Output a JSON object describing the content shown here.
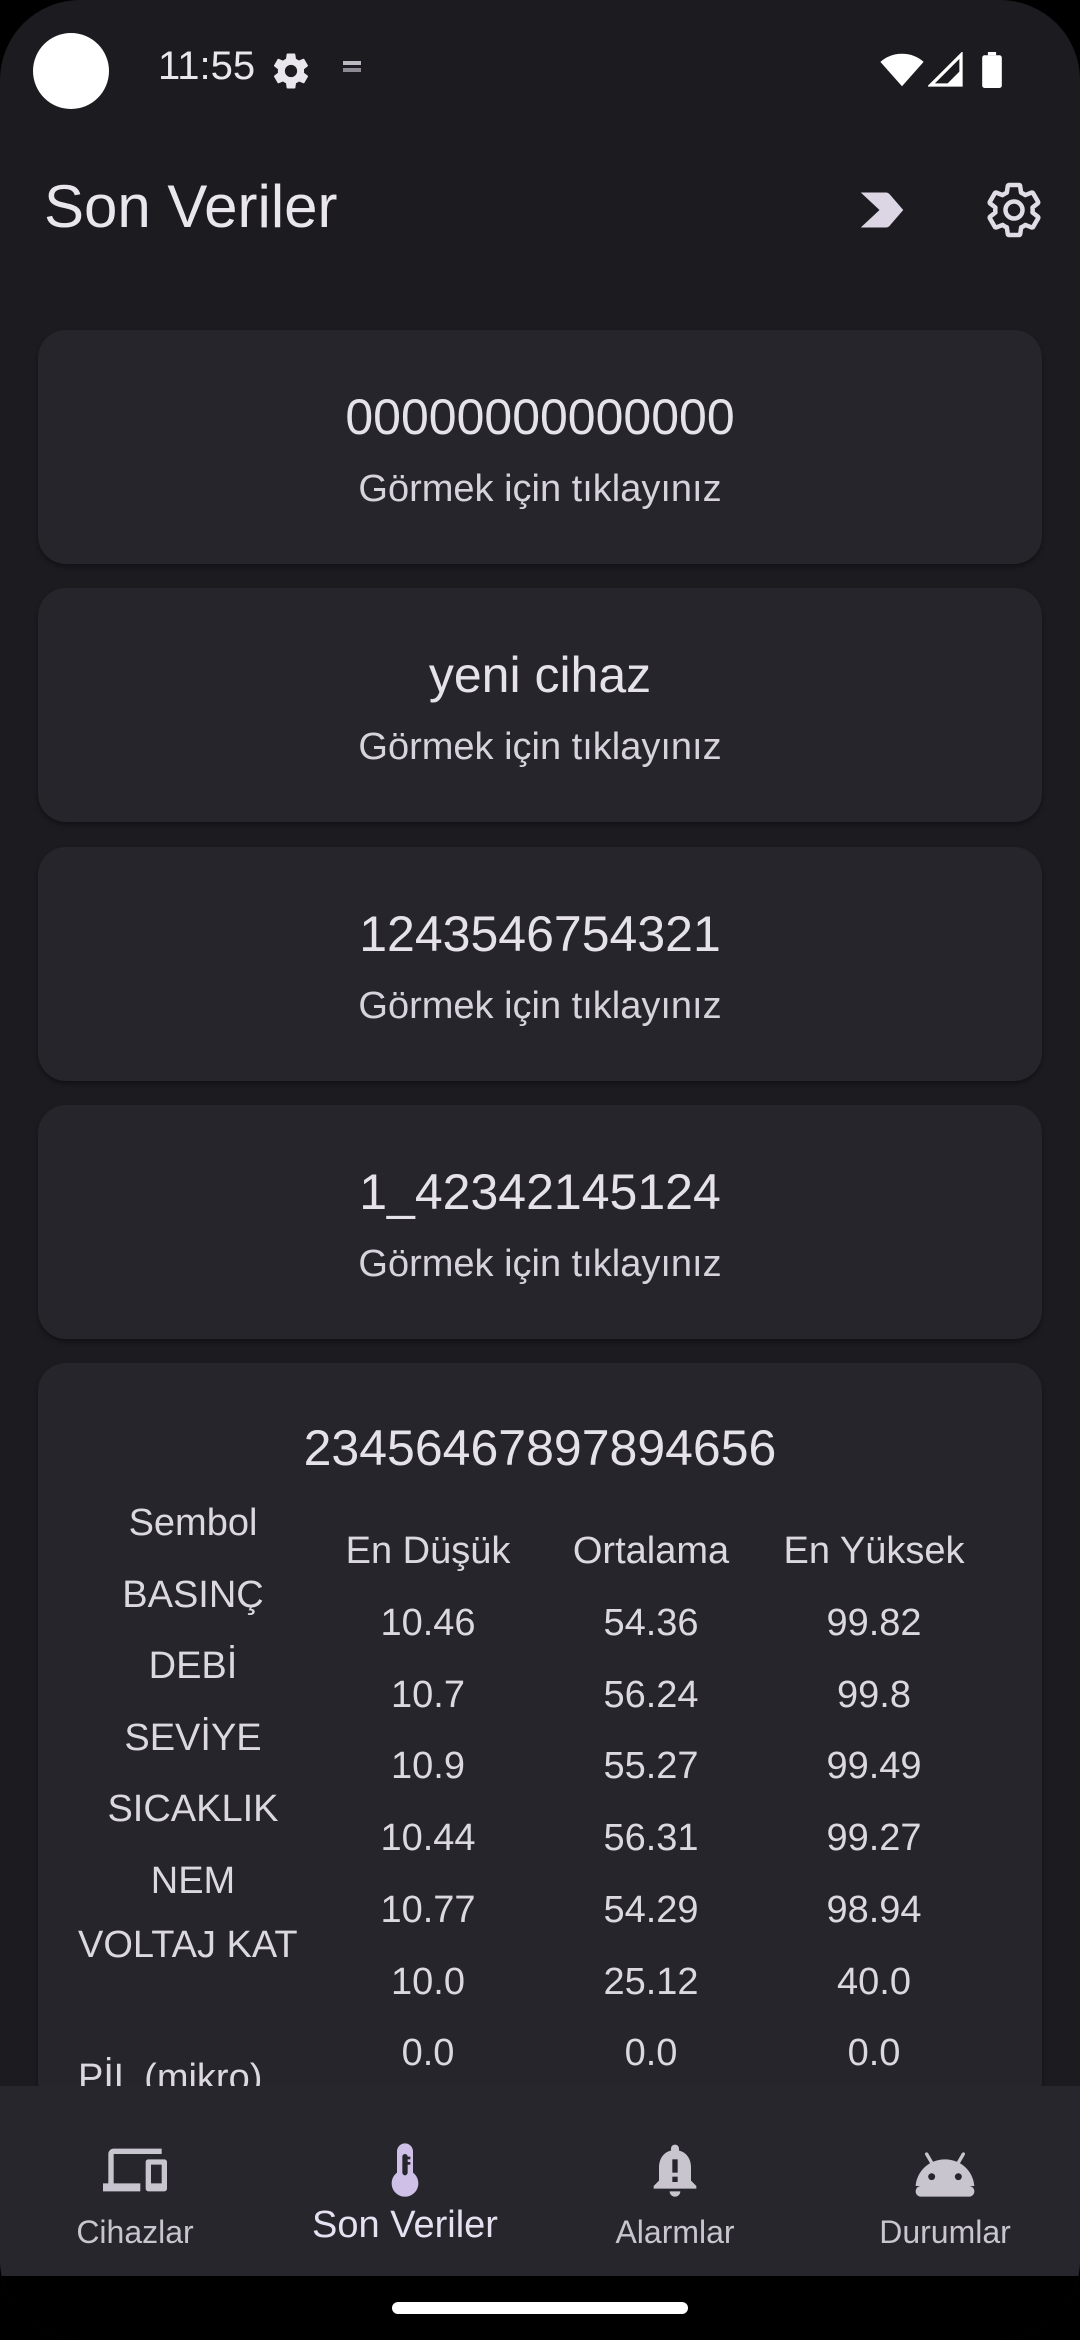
{
  "status": {
    "time": "11:55"
  },
  "app_bar": {
    "title": "Son Veriler"
  },
  "devices": [
    {
      "name": "00000000000000",
      "hint": "Görmek için tıklayınız"
    },
    {
      "name": "yeni cihaz",
      "hint": "Görmek için tıklayınız"
    },
    {
      "name": "1243546754321",
      "hint": "Görmek için tıklayınız"
    },
    {
      "name": "1_42342145124",
      "hint": "Görmek için tıklayınız"
    }
  ],
  "detail": {
    "name": "23456467897894656",
    "headers": {
      "symbol": "Sembol",
      "min": "En Düşük",
      "avg": "Ortalama",
      "max": "En Yüksek"
    },
    "rows": [
      {
        "symbol": "BASINÇ",
        "min": "10.46",
        "avg": "54.36",
        "max": "99.82"
      },
      {
        "symbol": "DEBİ",
        "min": "10.7",
        "avg": "56.24",
        "max": "99.8"
      },
      {
        "symbol": "SEVİYE",
        "min": "10.9",
        "avg": "55.27",
        "max": "99.49"
      },
      {
        "symbol": "SICAKLIK",
        "min": "10.44",
        "avg": "56.31",
        "max": "99.27"
      },
      {
        "symbol": "NEM",
        "min": "10.77",
        "avg": "54.29",
        "max": "98.94"
      },
      {
        "symbol": "VOLTAJ KAT",
        "min": "10.0",
        "avg": "25.12",
        "max": "40.0"
      },
      {
        "symbol": "PİL (mikro)",
        "min": "0.0",
        "avg": "0.0",
        "max": "0.0"
      }
    ]
  },
  "nav": {
    "items": [
      {
        "label": "Cihazlar",
        "icon": "devices-icon"
      },
      {
        "label": "Son Veriler",
        "icon": "thermometer-icon"
      },
      {
        "label": "Alarmlar",
        "icon": "alarm-bell-icon"
      },
      {
        "label": "Durumlar",
        "icon": "android-icon"
      }
    ],
    "active_index": 1
  },
  "colors": {
    "background": "#1c1b20",
    "card": "#26252b",
    "nav_bar": "#27262c",
    "active_icon": "#cfc0e8"
  }
}
